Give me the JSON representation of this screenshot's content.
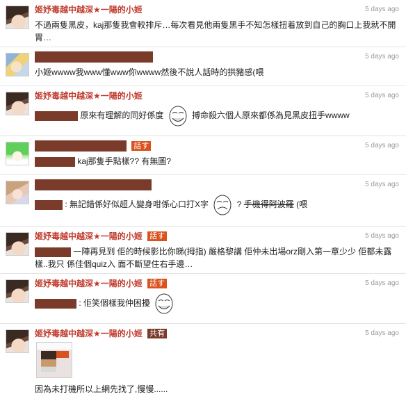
{
  "comments": [
    {
      "author": "姬妤毒越中越深★一陽的小姬",
      "time": "5 days ago",
      "text": "不過兩隻黑皮，kaj那隻我會較排斥…每次看見他兩隻黑手不知怎樣扭着放到自己的胸口上我就不開胃…"
    },
    {
      "author": "",
      "time": "5 days ago",
      "text": "小姬wwww我www懂www你wwww然後不說人話時的拱豬感(喂"
    },
    {
      "author": "姬妤毒越中越深★一陽的小姬",
      "time": "5 days ago",
      "text_before": "原來有理解的同好係度",
      "text_after": "搏命殺六個人原來都係為見黑皮扭手wwww"
    },
    {
      "author": "",
      "tag": "話す",
      "time": "5 days ago",
      "text": "kaj那隻手點樣?? 有無圖?"
    },
    {
      "author": "",
      "time": "5 days ago",
      "text_before": ": 無記錯係好似超人變身咁係心口打X字",
      "text_mid": "? ",
      "text_strike": "手機得阿波羅",
      "text_after": "(喂"
    },
    {
      "author": "姬妤毒越中越深★一陽的小姬",
      "tag": "話す",
      "time": "5 days ago",
      "text": "一陣再見到 佢的時候影比你睇(拇指) 嚴格黎講 佢仲未出場orz剛入第一章少少 佢都未露樣..我只 係佳個quiz入 面不斷望住右手邊…"
    },
    {
      "author": "姬妤毒越中越深★一陽的小姬",
      "tag": "話す",
      "time": "5 days ago",
      "text": ": 佢笑個樣我仲困擾"
    },
    {
      "author": "姬妤毒越中越深★一陽的小姬",
      "tag": "共有",
      "time": "5 days ago",
      "text": "因為未打機所以上網先找了,慢慢......"
    }
  ],
  "icons": {
    "avatar_1": "girl-avatar-icon",
    "avatar_2": "blond-avatar-icon",
    "avatar_3": "green-hair-avatar-icon",
    "avatar_4": "pink-avatar-icon",
    "face": "troll-face-icon",
    "thumbnail": "game-screenshot-thumbnail"
  },
  "colors": {
    "author": "#c0392b",
    "tag_orange": "#d9531e",
    "tag_brown": "#7a3b2a",
    "time": "#999999"
  }
}
